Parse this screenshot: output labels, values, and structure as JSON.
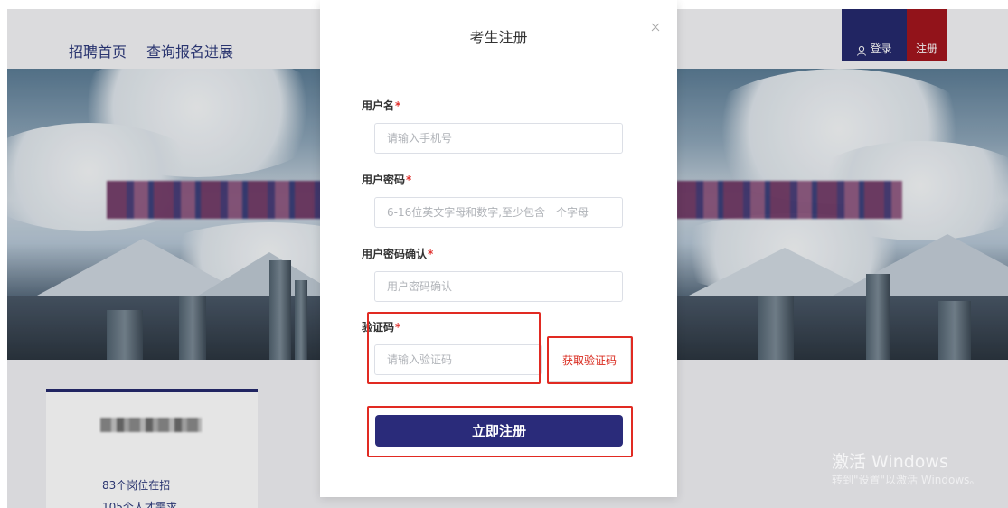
{
  "nav": {
    "home": "招聘首页",
    "progress": "查询报名进展",
    "login": "登录",
    "register": "注册"
  },
  "card": {
    "positions": "83个岗位在招",
    "talent": "105个人才需求"
  },
  "watermark": {
    "title": "激活 Windows",
    "subtitle": "转到\"设置\"以激活 Windows。"
  },
  "modal": {
    "title": "考生注册",
    "required_mark": "*",
    "fields": {
      "username": {
        "label": "用户名",
        "placeholder": "请输入手机号",
        "value": ""
      },
      "password": {
        "label": "用户密码",
        "placeholder": "6-16位英文字母和数字,至少包含一个字母",
        "value": ""
      },
      "confirm": {
        "label": "用户密码确认",
        "placeholder": "用户密码确认",
        "value": ""
      },
      "captcha": {
        "label": "验证码",
        "placeholder": "请输入验证码",
        "value": ""
      }
    },
    "get_code": "获取验证码",
    "submit": "立即注册"
  },
  "colors": {
    "primary": "#2a2b7a",
    "danger": "#e12a22",
    "register_red": "#a3161d"
  }
}
